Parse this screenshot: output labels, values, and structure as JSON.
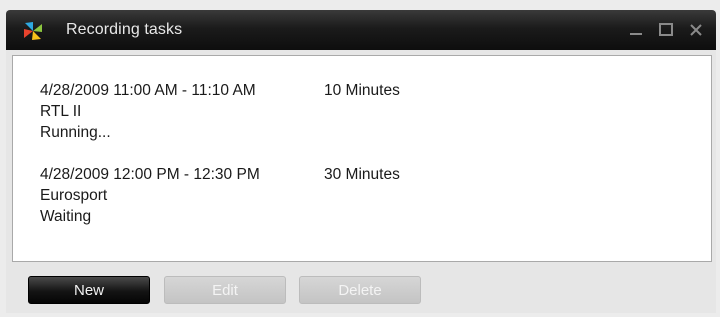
{
  "window": {
    "title": "Recording tasks",
    "app_icon": "pinwheel-app-icon",
    "controls": [
      "minimize-icon",
      "maximize-icon",
      "close-icon"
    ]
  },
  "tasks": [
    {
      "time": "4/28/2009 11:00 AM - 11:10 AM",
      "duration": "10 Minutes",
      "channel": "RTL II",
      "status": "Running..."
    },
    {
      "time": "4/28/2009 12:00 PM - 12:30 PM",
      "duration": "30 Minutes",
      "channel": "Eurosport",
      "status": "Waiting"
    }
  ],
  "buttons": {
    "new": "New",
    "edit": "Edit",
    "delete": "Delete"
  },
  "colors": {
    "titlebar": "#111111",
    "panel": "#ffffff",
    "primary_button": "#141414",
    "disabled_button": "#c8c8c8"
  }
}
